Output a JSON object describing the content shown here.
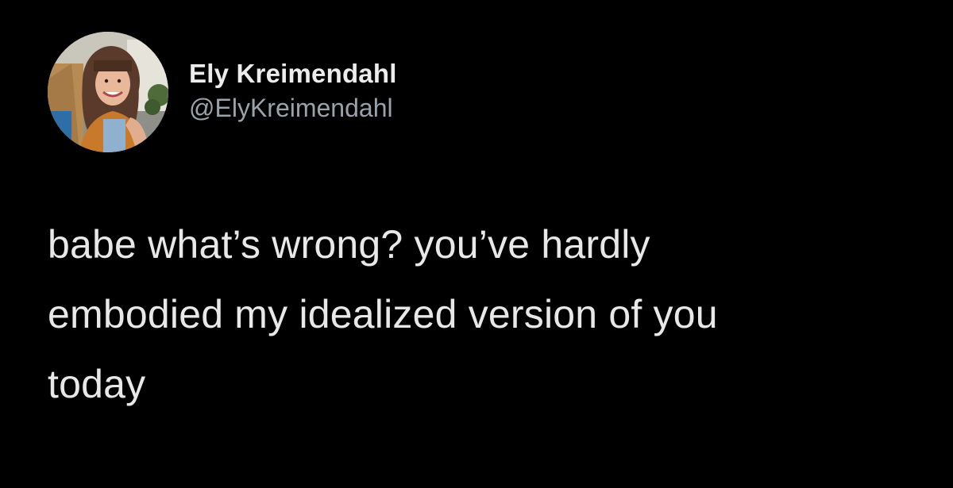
{
  "tweet": {
    "author": {
      "display_name": "Ely Kreimendahl",
      "handle": "@ElyKreimendahl",
      "avatar_icon": "profile-photo"
    },
    "text_lines": [
      "babe what’s wrong? you’ve hardly",
      "embodied my idealized version of you",
      "today"
    ]
  },
  "colors": {
    "background": "#000000",
    "name": "#ececec",
    "handle": "#9aa2aa",
    "text": "#e8e8e8"
  }
}
